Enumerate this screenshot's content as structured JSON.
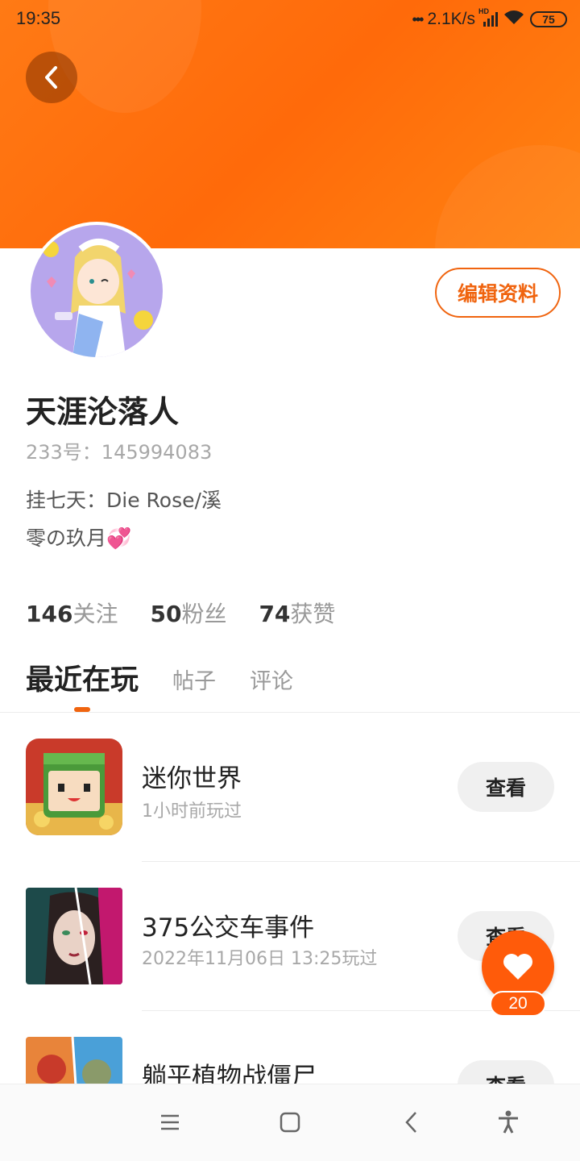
{
  "status_bar": {
    "time": "19:35",
    "network_speed": "2.1K/s",
    "network_badge": "HD",
    "battery": "75"
  },
  "profile": {
    "edit_label": "编辑资料",
    "username": "天涯沦落人",
    "user_id": "233号：145994083",
    "bio_line1": "挂七天：Die Rose/溪",
    "bio_line2": "零の玖月💞"
  },
  "stats": [
    {
      "value": "146",
      "label": "关注"
    },
    {
      "value": "50",
      "label": "粉丝"
    },
    {
      "value": "74",
      "label": "获赞"
    }
  ],
  "tabs": [
    {
      "label": "最近在玩",
      "active": true
    },
    {
      "label": "帖子",
      "active": false
    },
    {
      "label": "评论",
      "active": false
    }
  ],
  "games": [
    {
      "title": "迷你世界",
      "played": "1小时前玩过",
      "button": "查看",
      "icon": "mini-world-icon"
    },
    {
      "title": "375公交车事件",
      "played": "2022年11月06日 13:25玩过",
      "button": "查看",
      "icon": "bus-375-icon"
    },
    {
      "title": "躺平植物战僵尸",
      "played": "",
      "button": "查看",
      "icon": "plants-zombies-icon"
    }
  ],
  "like_fab": {
    "count": "20",
    "icon": "heart-icon"
  },
  "colors": {
    "accent": "#f0640f",
    "header": "#ff7412",
    "fab": "#ff5b0a"
  }
}
